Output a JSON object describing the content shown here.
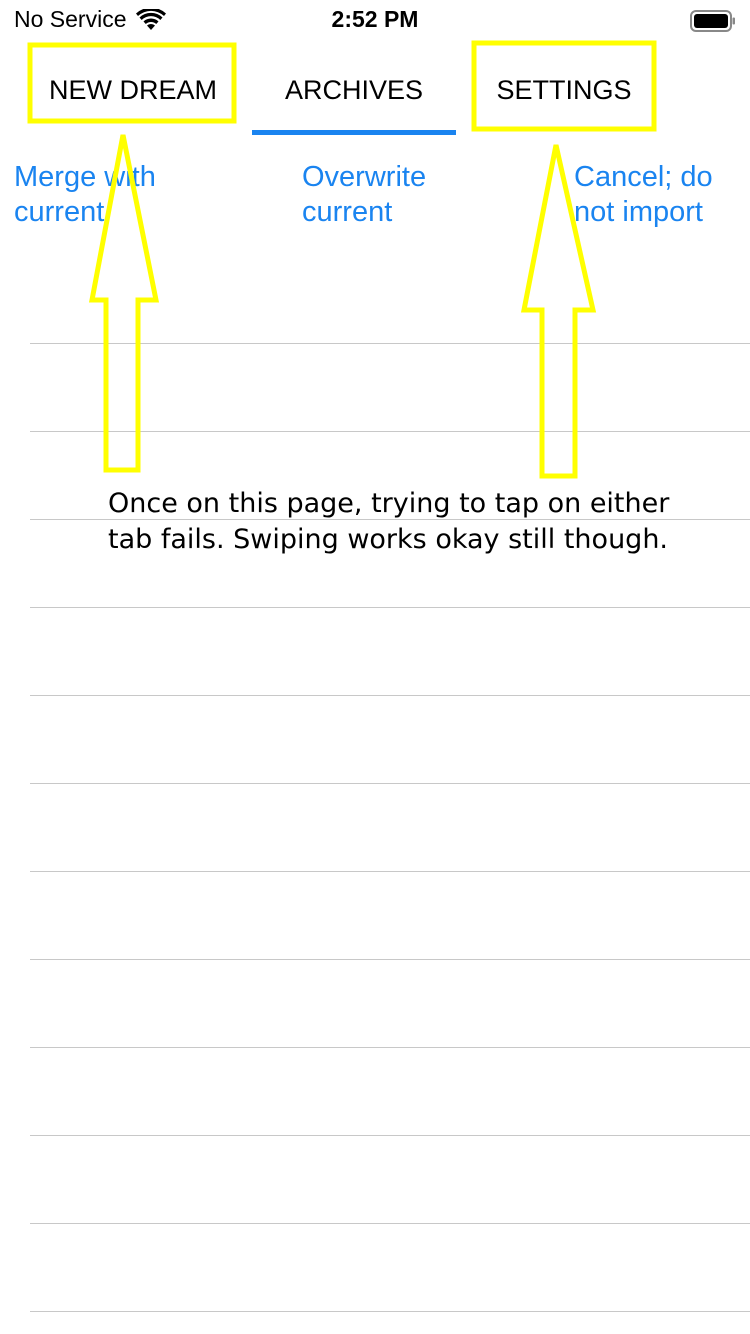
{
  "status_bar": {
    "carrier": "No Service",
    "time": "2:52 PM",
    "wifi_icon": "wifi-icon",
    "battery_icon": "battery-icon"
  },
  "tabs": [
    {
      "label": "NEW DREAM",
      "selected": false
    },
    {
      "label": "ARCHIVES",
      "selected": true
    },
    {
      "label": "SETTINGS",
      "selected": false
    }
  ],
  "actions": {
    "merge": "Merge with current",
    "overwrite": "Overwrite current",
    "cancel": "Cancel; do not import"
  },
  "annotation": {
    "note": "Once on this page, trying to tap on either tab fails. Swiping works okay still though.",
    "highlight_color": "#ffff00"
  },
  "colors": {
    "accent": "#1a84f0",
    "separator": "#c8c8c8"
  }
}
